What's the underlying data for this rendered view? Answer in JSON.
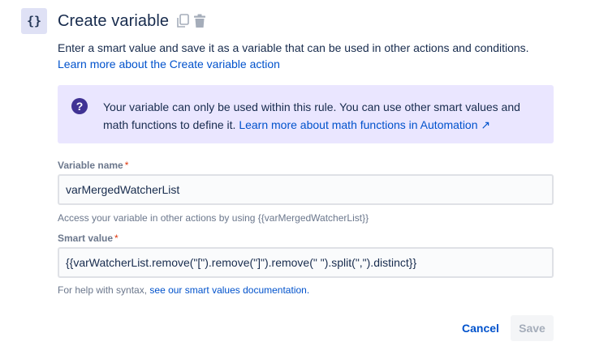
{
  "header": {
    "icon_text": "{}",
    "title": "Create variable",
    "copy_icon": "copy-icon",
    "delete_icon": "trash-icon"
  },
  "description": {
    "text": "Enter a smart value and save it as a variable that can be used in other actions and conditions.",
    "link_text": "Learn more about the Create variable action"
  },
  "info_panel": {
    "icon": "question-circle-icon",
    "text": "Your variable can only be used within this rule. You can use other smart values and math functions to define it.",
    "link_text": "Learn more about math functions in Automation ↗"
  },
  "form": {
    "variable_name": {
      "label": "Variable name",
      "required_marker": "*",
      "value": "varMergedWatcherList",
      "helper": "Access your variable in other actions by using {{varMergedWatcherList}}"
    },
    "smart_value": {
      "label": "Smart value",
      "required_marker": "*",
      "value": "{{varWatcherList.remove(\"[\").remove(\"]\").remove(\" \").split(\",\").distinct}}",
      "helper_prefix": "For help with syntax,",
      "helper_link": "see our smart values documentation."
    }
  },
  "actions": {
    "cancel_label": "Cancel",
    "save_label": "Save"
  },
  "colors": {
    "link": "#0052cc",
    "info_bg": "#eae6ff",
    "info_icon": "#403294",
    "required": "#de350b"
  }
}
